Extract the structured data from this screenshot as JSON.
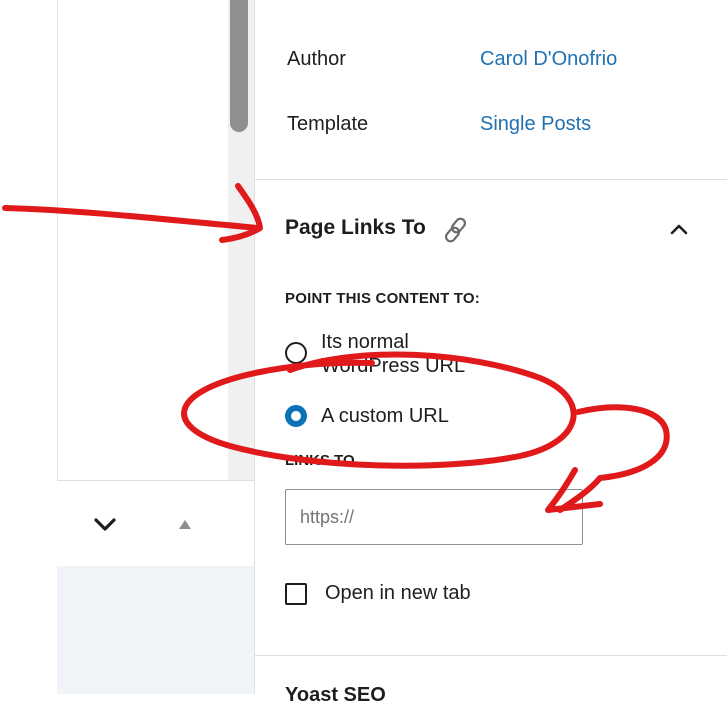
{
  "post_meta": {
    "author": {
      "label": "Author",
      "value": "Carol D'Onofrio"
    },
    "template": {
      "label": "Template",
      "value": "Single Posts"
    }
  },
  "page_links_panel": {
    "title": "Page Links To",
    "title_icon": "link-icon",
    "toggle_icon": "chevron-up-icon",
    "section_label": "POINT THIS CONTENT TO:",
    "options": [
      {
        "label": "Its normal WordPress URL",
        "selected": false
      },
      {
        "label": "A custom URL",
        "selected": true
      }
    ],
    "links_to_label": "LINKS TO",
    "url_input": {
      "value": "",
      "placeholder": "https://"
    },
    "open_new_tab": {
      "label": "Open in new tab",
      "checked": false
    }
  },
  "next_panel": {
    "title": "Yoast SEO"
  },
  "editor_controls": {
    "collapse_icon": "chevron-down-icon",
    "move_up_icon": "triangle-up-icon"
  },
  "colors": {
    "link_blue": "#2271b1",
    "radio_accent": "#0a72b5",
    "annotation_red": "#e0191b",
    "border": "#e0e0e0"
  }
}
